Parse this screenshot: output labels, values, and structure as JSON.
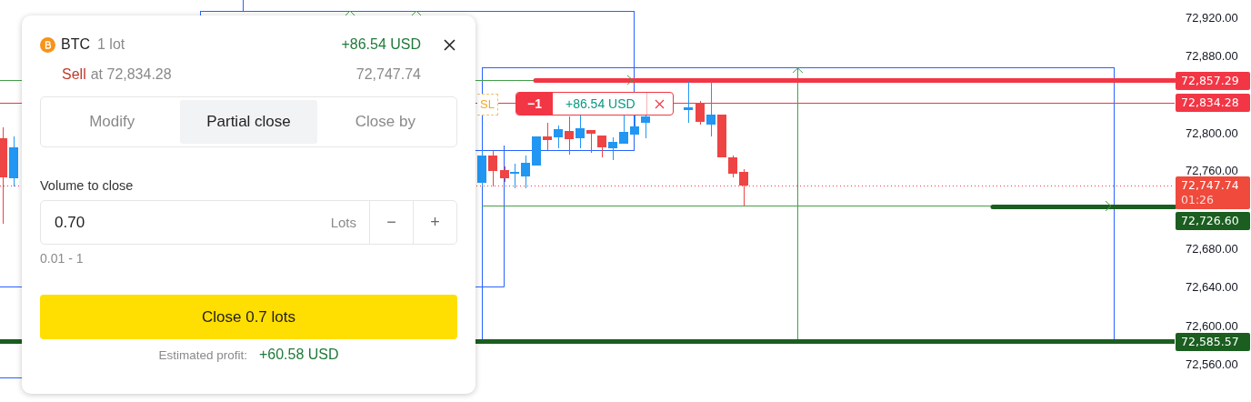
{
  "chart": {
    "price_axis": [
      "72,920.00",
      "72,880.00",
      "72,800.00",
      "72,760.00",
      "72,680.00",
      "72,640.00",
      "72,600.00",
      "72,560.00"
    ],
    "price_tags": [
      {
        "text": "72,857.29",
        "color": "#f23645"
      },
      {
        "text": "72,834.28",
        "color": "#f23645"
      },
      {
        "text": "72,747.74",
        "countdown": "01:26",
        "color": "#ef4a3c"
      },
      {
        "text": "72,726.60",
        "color": "#1b5e20"
      },
      {
        "text": "72,585.57",
        "color": "#1b5e20"
      }
    ],
    "sl_label": "SL",
    "position_label": {
      "volume": "−1",
      "profit": "+86.54 USD"
    }
  },
  "position_panel": {
    "symbol": "BTC",
    "volume": "1 lot",
    "profit": "+86.54 USD",
    "side": "Sell",
    "open_price": "at 72,834.28",
    "current_price": "72,747.74",
    "tabs": [
      {
        "label": "Modify",
        "selected": false
      },
      {
        "label": "Partial close",
        "selected": true
      },
      {
        "label": "Close by",
        "selected": false
      }
    ],
    "volume_field": {
      "label": "Volume to close",
      "value": "0.70",
      "unit": "Lots",
      "decrement": "−",
      "increment": "+",
      "range": "0.01 - 1"
    },
    "close_button": "Close 0.7 lots",
    "estimated_profit_label": "Estimated profit:",
    "estimated_profit": "+60.58 USD"
  }
}
